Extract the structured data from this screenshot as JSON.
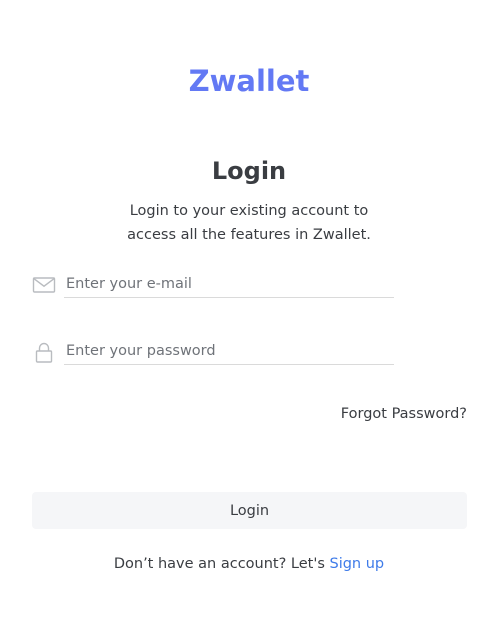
{
  "brand": {
    "name": "Zwallet",
    "color": "#6379F4"
  },
  "login": {
    "title": "Login",
    "subtitle": "Login to your existing account to access all the features in Zwallet."
  },
  "form": {
    "email": {
      "icon": "mail-icon",
      "placeholder": "Enter your e-mail",
      "value": ""
    },
    "password": {
      "icon": "lock-icon",
      "placeholder": "Enter your password",
      "value": ""
    },
    "forgot_label": "Forgot Password?",
    "submit_label": "Login"
  },
  "footer": {
    "prompt": "Don’t have an account? Let's",
    "signup_label": "Sign up",
    "link_color": "#3e7be9"
  }
}
